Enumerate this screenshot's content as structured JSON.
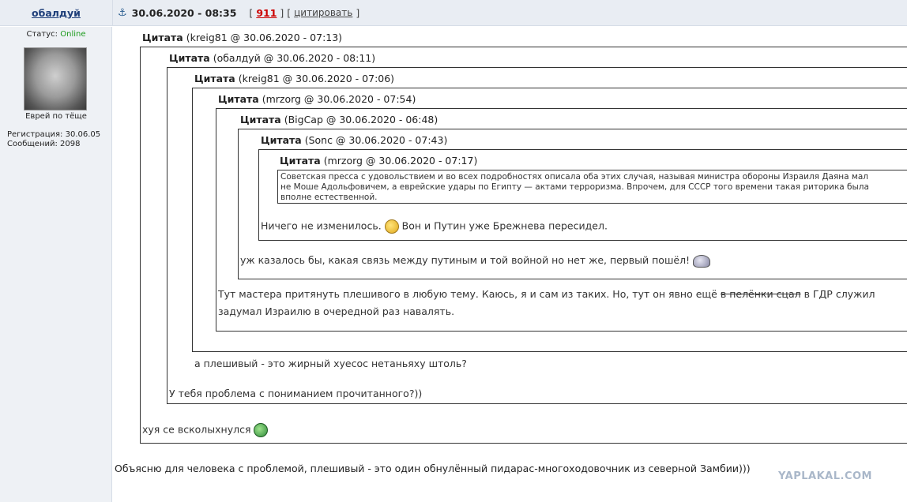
{
  "post": {
    "username": "обалдуй",
    "anchor_icon": "anchor-icon",
    "date": "30.06.2020 - 08:35",
    "bracket_open": "[",
    "bracket_mid": "] [",
    "bracket_close": "]",
    "rating": "911",
    "quote_label": "цитировать"
  },
  "user": {
    "status_label": "Статус:",
    "status_value": "Online",
    "avatar_caption": "Еврей по тёще",
    "registration": "Регистрация: 30.06.05",
    "messages": "Сообщений: 2098"
  },
  "quotes": {
    "q1_label": "Цитата",
    "q1_meta": "(kreig81 @ 30.06.2020 - 07:13)",
    "q2_label": "Цитата",
    "q2_meta": "(обалдуй @ 30.06.2020 - 08:11)",
    "q3_label": "Цитата",
    "q3_meta": "(kreig81 @ 30.06.2020 - 07:06)",
    "q4_label": "Цитата",
    "q4_meta": "(mrzorg @ 30.06.2020 - 07:54)",
    "q5_label": "Цитата",
    "q5_meta": "(BigCap @ 30.06.2020 - 06:48)",
    "q6_label": "Цитата",
    "q6_meta": "(Sonc @ 30.06.2020 - 07:43)",
    "q7_label": "Цитата",
    "q7_meta": "(mrzorg @ 30.06.2020 - 07:17)",
    "q7_body_line1": "Советская пресса с удовольствием и во всех подробностях описала оба этих случая, называя министра обороны Израиля Даяна мал",
    "q7_body_line2": "не Моше Адольфовичем, а еврейские удары по Египту — актами терроризма. Впрочем, для СССР того времени такая риторика была",
    "q7_body_line3": "вполне естественной.",
    "q6_reply_a": "Ничего не изменилось.",
    "q6_reply_b": "Вон и Путин уже Брежнева пересидел.",
    "q5_reply": "уж казалось бы, какая связь между путиным и той войной но нет же, первый пошёл!",
    "q4_reply_a": "Тут мастера притянуть плешивого в любую тему. Каюсь, я и сам из таких. Но, тут он явно ещё",
    "q4_reply_strike": "в пелёнки сцал",
    "q4_reply_b": "в ГДР служил",
    "q4_reply_line2": "задумал Израилю в очередной раз навалять.",
    "q3_reply": "а плешивый - это жирный хуесос нетаньяху штоль?",
    "q2_reply": "У тебя проблема с пониманием прочитанного?))",
    "q1_reply": "хуя се всколыхнулся"
  },
  "main_reply": "Объясню для человека с проблемой, плешивый - это один обнулённый пидарас-многоходовочник из северной Замбии)))",
  "watermark": "YAPLAKAL.COM"
}
